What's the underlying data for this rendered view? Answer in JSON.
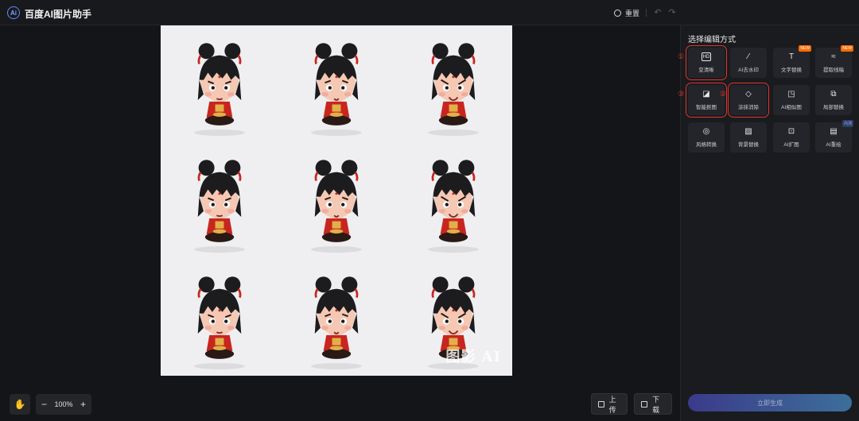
{
  "app": {
    "logo_text": "Ai",
    "title": "百度AI图片助手"
  },
  "toolbar": {
    "reset_label": "重置",
    "undo_icon": "undo-icon",
    "redo_icon": "redo-icon"
  },
  "canvas": {
    "watermark": "图影 AI",
    "zoom_level": "100%",
    "zoom_out": "−",
    "zoom_in": "+",
    "upload_label": "上传",
    "download_label": "下载",
    "characters": [
      {
        "expression": "smirk"
      },
      {
        "expression": "surprised"
      },
      {
        "expression": "angry-shout"
      },
      {
        "expression": "suspicious"
      },
      {
        "expression": "grin"
      },
      {
        "expression": "grumpy"
      },
      {
        "expression": "furious"
      },
      {
        "expression": "scowl"
      },
      {
        "expression": "annoyed"
      }
    ]
  },
  "sidebar": {
    "title": "选择编辑方式",
    "tools": [
      {
        "label": "变清晰",
        "icon": "hd-icon",
        "glyph": "HD",
        "badge": "",
        "annotation": "①"
      },
      {
        "label": "AI去水印",
        "icon": "magic-wand-icon",
        "glyph": "⁄",
        "badge": "",
        "annotation": ""
      },
      {
        "label": "文字替换",
        "icon": "text-replace-icon",
        "glyph": "T",
        "badge": "NEW",
        "annotation": ""
      },
      {
        "label": "提取线稿",
        "icon": "line-extract-icon",
        "glyph": "≈",
        "badge": "NEW",
        "annotation": ""
      },
      {
        "label": "智能抠图",
        "icon": "cutout-icon",
        "glyph": "◪",
        "badge": "",
        "annotation": "③"
      },
      {
        "label": "涂抹消除",
        "icon": "eraser-icon",
        "glyph": "◇",
        "badge": "",
        "annotation": "②"
      },
      {
        "label": "AI相似图",
        "icon": "similar-image-icon",
        "glyph": "◳",
        "badge": "",
        "annotation": ""
      },
      {
        "label": "局部替换",
        "icon": "partial-replace-icon",
        "glyph": "⧉",
        "badge": "",
        "annotation": ""
      },
      {
        "label": "风格转换",
        "icon": "style-convert-icon",
        "glyph": "◎",
        "badge": "",
        "annotation": ""
      },
      {
        "label": "背景替换",
        "icon": "background-replace-icon",
        "glyph": "▨",
        "badge": "",
        "annotation": ""
      },
      {
        "label": "AI扩图",
        "icon": "expand-image-icon",
        "glyph": "⊡",
        "badge": "",
        "annotation": ""
      },
      {
        "label": "AI重绘",
        "icon": "redraw-icon",
        "glyph": "▤",
        "badge": "内测",
        "annotation": ""
      }
    ],
    "generate_label": "立即生成"
  }
}
